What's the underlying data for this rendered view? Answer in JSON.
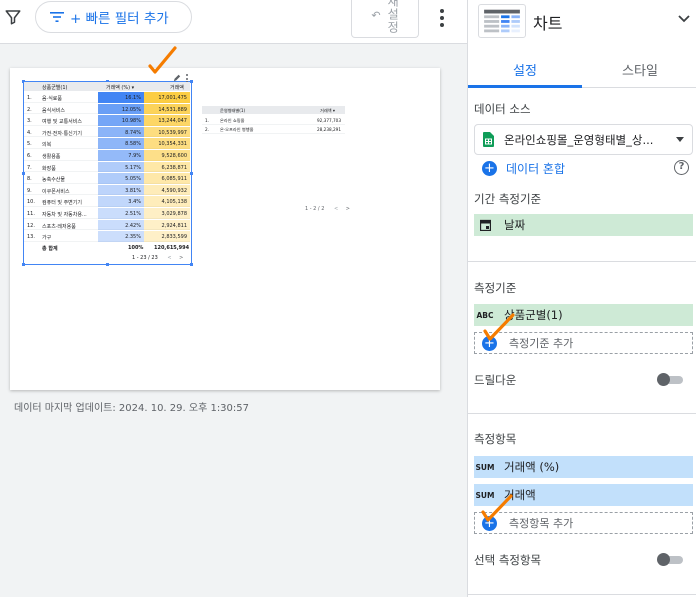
{
  "toolbar": {
    "quick_filter_label": "+ 빠른 필터 추가",
    "reset_label": "재설정"
  },
  "table1": {
    "headers": [
      "상품군별(1)",
      "거래액 (%) ▾",
      "거래액"
    ],
    "rows": [
      {
        "num": "1.",
        "name": "음·식료품",
        "pct": "16.1%",
        "amt": "17,001,475",
        "pct_value": 16.1,
        "amt_value": 17001475
      },
      {
        "num": "2.",
        "name": "음식서비스",
        "pct": "12.05%",
        "amt": "14,531,889",
        "pct_value": 12.05,
        "amt_value": 14531889
      },
      {
        "num": "3.",
        "name": "여행 및 교통서비스",
        "pct": "10.98%",
        "amt": "13,244,047",
        "pct_value": 10.98,
        "amt_value": 13244047
      },
      {
        "num": "4.",
        "name": "가전·전자·통신기기",
        "pct": "8.74%",
        "amt": "10,539,997",
        "pct_value": 8.74,
        "amt_value": 10539997
      },
      {
        "num": "5.",
        "name": "의복",
        "pct": "8.58%",
        "amt": "10,354,331",
        "pct_value": 8.58,
        "amt_value": 10354331
      },
      {
        "num": "6.",
        "name": "생활용품",
        "pct": "7.9%",
        "amt": "9,528,600",
        "pct_value": 7.9,
        "amt_value": 9528600
      },
      {
        "num": "7.",
        "name": "화장품",
        "pct": "5.17%",
        "amt": "6,238,871",
        "pct_value": 5.17,
        "amt_value": 6238871
      },
      {
        "num": "8.",
        "name": "농축수산물",
        "pct": "5.05%",
        "amt": "6,085,911",
        "pct_value": 5.05,
        "amt_value": 6085911
      },
      {
        "num": "9.",
        "name": "이쿠폰서비스",
        "pct": "3.81%",
        "amt": "4,590,932",
        "pct_value": 3.81,
        "amt_value": 4590932
      },
      {
        "num": "10.",
        "name": "컴퓨터 및 주변기기",
        "pct": "3.4%",
        "amt": "4,105,138",
        "pct_value": 3.4,
        "amt_value": 4105138
      },
      {
        "num": "11.",
        "name": "자동차 및 자동차용...",
        "pct": "2.51%",
        "amt": "3,029,878",
        "pct_value": 2.51,
        "amt_value": 3029878
      },
      {
        "num": "12.",
        "name": "스포츠·레저용품",
        "pct": "2.42%",
        "amt": "2,924,811",
        "pct_value": 2.42,
        "amt_value": 2924811
      },
      {
        "num": "13.",
        "name": "가구",
        "pct": "2.35%",
        "amt": "2,833,599",
        "pct_value": 2.35,
        "amt_value": 2833599
      }
    ],
    "total": {
      "label": "총 합계",
      "pct": "100%",
      "amt": "120,615,994"
    },
    "pagination": "1 - 23 / 23"
  },
  "table2": {
    "headers": [
      "운영형태별(1)",
      "거래액 ▾"
    ],
    "rows": [
      {
        "num": "1.",
        "name": "온라인 쇼핑몰",
        "amt": "92,377,703"
      },
      {
        "num": "2.",
        "name": "온·오프라인 병행몰",
        "amt": "28,238,291"
      }
    ],
    "pagination": "1 - 2 / 2"
  },
  "last_updated": "데이터 마지막 업데이트: 2024. 10. 29. 오후 1:30:57",
  "panel": {
    "chart_type": "차트",
    "tabs": [
      "설정",
      "스타일"
    ],
    "data_source_title": "데이터 소스",
    "data_source_name": "온라인쇼핑몰_운영형태별_상...",
    "blend_label": "데이터 혼합",
    "date_range_title": "기간 측정기준",
    "date_field": "날짜",
    "dimension_title": "측정기준",
    "dimension_type": "ABC",
    "dimension_field": "상품군별(1)",
    "add_dimension": "측정기준 추가",
    "drilldown_label": "드릴다운",
    "metric_title": "측정항목",
    "metric_type": "SUM",
    "metrics": [
      "거래액 (%)",
      "거래액"
    ],
    "add_metric": "측정항목 추가",
    "optional_metrics_label": "선택 측정항목"
  },
  "colors": {
    "accent": "#1a73e8",
    "pct_heat": "#4285f4",
    "amt_heat": "#fbbc04",
    "annotation": "#f57c00"
  }
}
